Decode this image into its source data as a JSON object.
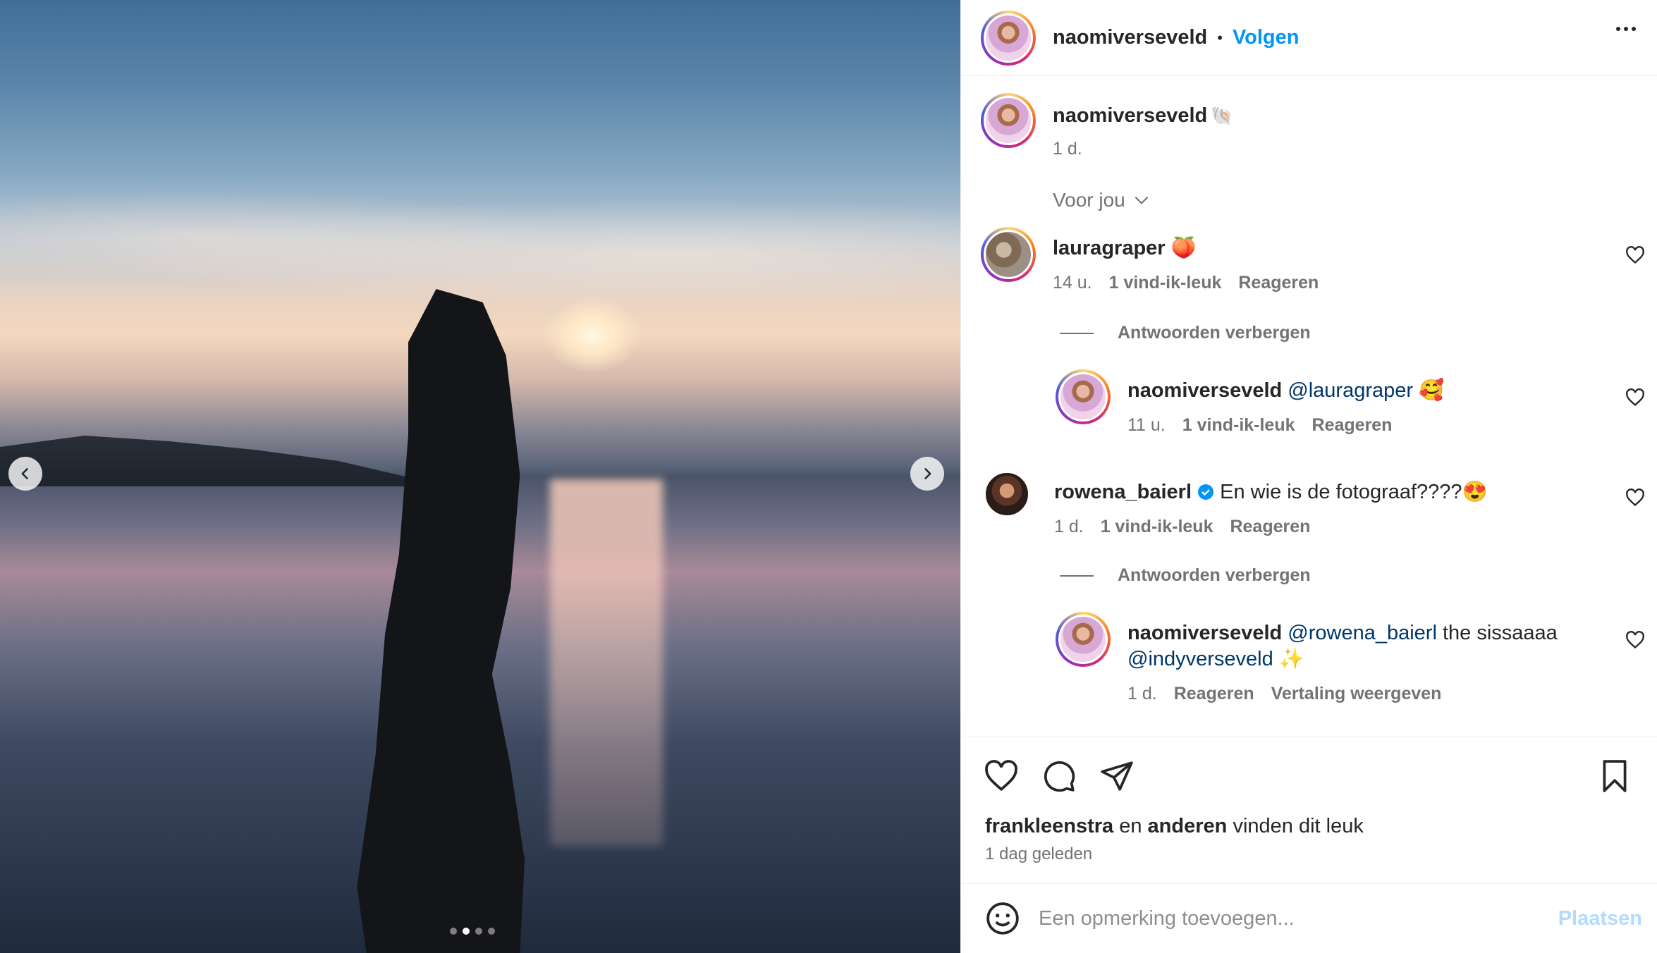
{
  "post": {
    "author": "naomiverseveld",
    "separator": "•",
    "follow_label": "Volgen",
    "caption_emoji": "🐚",
    "caption_time": "1 d.",
    "sort_label": "Voor jou",
    "carousel": {
      "dots": 4,
      "active_index": 1
    }
  },
  "comments": [
    {
      "user": "lauragraper",
      "text": "🍑",
      "time": "14 u.",
      "likes": "1 vind-ik-leuk",
      "reply": "Reageren",
      "hide_replies": "Antwoorden verbergen",
      "replies": [
        {
          "user": "naomiverseveld",
          "mention": "@lauragraper",
          "text": "🥰",
          "time": "11 u.",
          "likes": "1 vind-ik-leuk",
          "reply": "Reageren"
        }
      ]
    },
    {
      "user": "rowena_baierl",
      "verified": true,
      "text": "En wie is de fotograaf????😍",
      "time": "1 d.",
      "likes": "1 vind-ik-leuk",
      "reply": "Reageren",
      "hide_replies": "Antwoorden verbergen",
      "replies": [
        {
          "user": "naomiverseveld",
          "mention": "@rowena_baierl",
          "text": "the sissaaaa",
          "mention2": "@indyverseveld",
          "text2": "✨",
          "time": "1 d.",
          "reply": "Reageren",
          "translate": "Vertaling weergeven"
        }
      ]
    }
  ],
  "engagement": {
    "liked_by": "frankleenstra",
    "and": "en",
    "others": "anderen",
    "suffix": "vinden dit leuk",
    "date": "1 dag geleden"
  },
  "composer": {
    "placeholder": "Een opmerking toevoegen...",
    "post_label": "Plaatsen"
  },
  "colors": {
    "accent": "#0095f6",
    "muted": "#737373",
    "mention": "#00376b",
    "post_disabled": "#b3dbff"
  }
}
